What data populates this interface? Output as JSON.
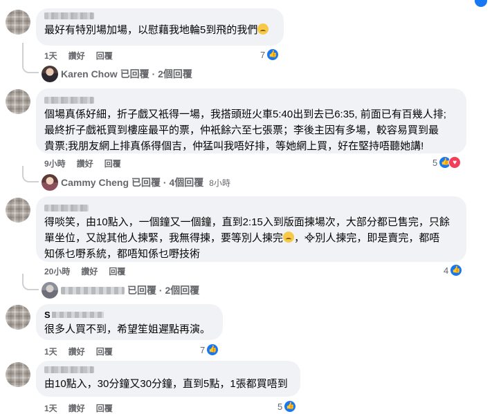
{
  "comments": [
    {
      "text": "最好有特別場加場，以慰藉我地輪5到飛的我們",
      "emoji": "sad-face",
      "time": "1天",
      "like": "讚好",
      "reply": "回覆",
      "reactions": "7"
    },
    {
      "text": "個場真係好細，折子戲又衹得一場，我搭頭班火車5:40出到去已6:35, 前面已有百幾人排;\n最終折子戲衹買到樓座最平的票，仲衹餘六至七張票；李後主因有多場，較容易買到最\n貴票;我朋友網上排真係得個吉，仲猛叫我唔好排，等她網上買，好在堅持唔聽她講!",
      "time": "9小時",
      "like": "讚好",
      "reply": "回覆",
      "reactions": "5"
    },
    {
      "text_a": "得啖笑，由10點入，一個鐘又一個鐘，直到2:15入到版面揀場次，大部分都已售完，只餘\n單坐位，又說其他人揀緊，我無得揀，要等別人揀完",
      "text_b": "，",
      "text_c": "別人揀完，即是賣完，都唔\n知係乜嘢系統，都唔知係乜嘢技術",
      "time": "20小時",
      "like": "讚好",
      "reply": "回覆",
      "reactions": "4"
    },
    {
      "author_initial": "S",
      "text": "很多人買不到，希望笙姐遲點再演。",
      "time": "1天",
      "like": "讚好",
      "reply": "回覆",
      "reactions": "7"
    },
    {
      "text": "由10點入，30分鐘又30分鐘，直到5點，1張都買唔到",
      "time": "1天",
      "like": "讚好",
      "reply": "回覆",
      "reactions": "5"
    }
  ],
  "replies": [
    {
      "name": "Karen Chow",
      "summary": "已回覆 · 2個回覆",
      "time": ""
    },
    {
      "name": "Cammy Cheng",
      "summary": "已回覆 · 4個回覆",
      "time": "8小時"
    },
    {
      "name": "",
      "summary": "已回覆 · 2個回覆",
      "time": ""
    }
  ],
  "colors": {
    "like": "#1877f2",
    "love": "#f33e58",
    "bubble": "#f0f2f5",
    "meta": "#65676b"
  },
  "icons": {
    "like": "thumbs-up-icon",
    "love": "heart-icon"
  }
}
